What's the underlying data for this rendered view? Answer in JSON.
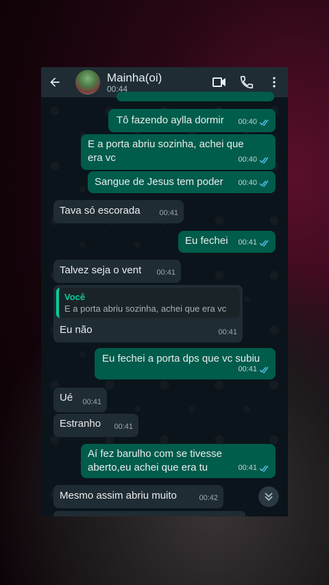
{
  "header": {
    "contact_name": "Mainha(oi)",
    "last_seen": "00:44"
  },
  "icons": {
    "back": "arrow-left-icon",
    "video": "video-camera-icon",
    "call": "phone-icon",
    "menu": "more-vertical-icon",
    "read": "double-check-icon",
    "scroll": "double-chevron-down-icon"
  },
  "colors": {
    "outgoing_bubble": "#005c4b",
    "incoming_bubble": "#202c33",
    "read_ticks": "#53bdeb",
    "quote_accent": "#06cf9c"
  },
  "messages": [
    {
      "dir": "out",
      "text": "Tô fazendo aylla dormir",
      "time": "00:40",
      "read": true
    },
    {
      "dir": "out",
      "text": "E a porta abriu sozinha, achei que era vc",
      "time": "00:40",
      "read": true
    },
    {
      "dir": "out",
      "text": "Sangue de Jesus tem poder",
      "time": "00:40",
      "read": true
    },
    {
      "dir": "in",
      "text": "Tava só  escorada",
      "time": "00:41"
    },
    {
      "dir": "out",
      "text": "Eu fechei",
      "time": "00:41",
      "read": true
    },
    {
      "dir": "in",
      "text": "Talvez seja o vent",
      "time": "00:41"
    },
    {
      "dir": "in",
      "text": "Eu não",
      "time": "00:41",
      "quote": {
        "author": "Você",
        "text": "E a porta abriu sozinha, achei que era vc"
      }
    },
    {
      "dir": "out",
      "text": "Eu fechei a porta dps que vc subiu",
      "time": "00:41",
      "read": true
    },
    {
      "dir": "in",
      "text": "Ué",
      "time": "00:41"
    },
    {
      "dir": "in",
      "text": "Estranho",
      "time": "00:41"
    },
    {
      "dir": "out",
      "text": "Aí fez barulho com se tivesse aberto,eu achei que era tu",
      "time": "00:41",
      "read": true
    },
    {
      "dir": "in",
      "text": "Mesmo assim abriu muito",
      "time": "00:42"
    }
  ]
}
